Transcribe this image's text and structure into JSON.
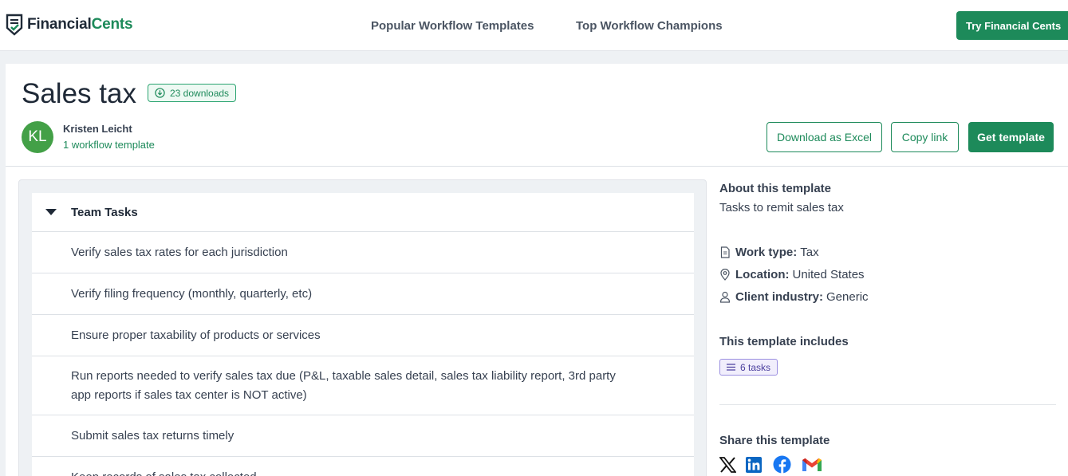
{
  "nav": {
    "logo_part1": "Financial",
    "logo_part2": "Cents",
    "link1": "Popular Workflow Templates",
    "link2": "Top Workflow Champions",
    "cta": "Try Financial Cents"
  },
  "template": {
    "title": "Sales tax",
    "downloads": "23 downloads",
    "author_initials": "KL",
    "author_name": "Kristen Leicht",
    "author_templates": "1 workflow template",
    "btn_excel": "Download as Excel",
    "btn_copy": "Copy link",
    "btn_get": "Get template"
  },
  "tasks": {
    "section_title": "Team Tasks",
    "items": [
      "Verify sales tax rates for each jurisdiction",
      "Verify filing frequency (monthly, quarterly, etc)",
      "Ensure proper taxability of products or services",
      "Run reports needed to verify sales tax due (P&L, taxable sales detail, sales tax liability report, 3rd party app reports if sales tax center is NOT active)",
      "Submit sales tax returns timely",
      "Keep records of sales tax collected"
    ]
  },
  "sidebar": {
    "about_label": "About this template",
    "about_text": "Tasks to remit sales tax",
    "work_type_label": "Work type:",
    "work_type_value": "Tax",
    "location_label": "Location:",
    "location_value": "United States",
    "industry_label": "Client industry:",
    "industry_value": "Generic",
    "includes_label": "This template includes",
    "tasks_count": "6 tasks",
    "share_label": "Share this template"
  },
  "colors": {
    "brand_green": "#1d8a5a",
    "avatar_green": "#43a047",
    "badge_purple": "#4b3f9e"
  }
}
